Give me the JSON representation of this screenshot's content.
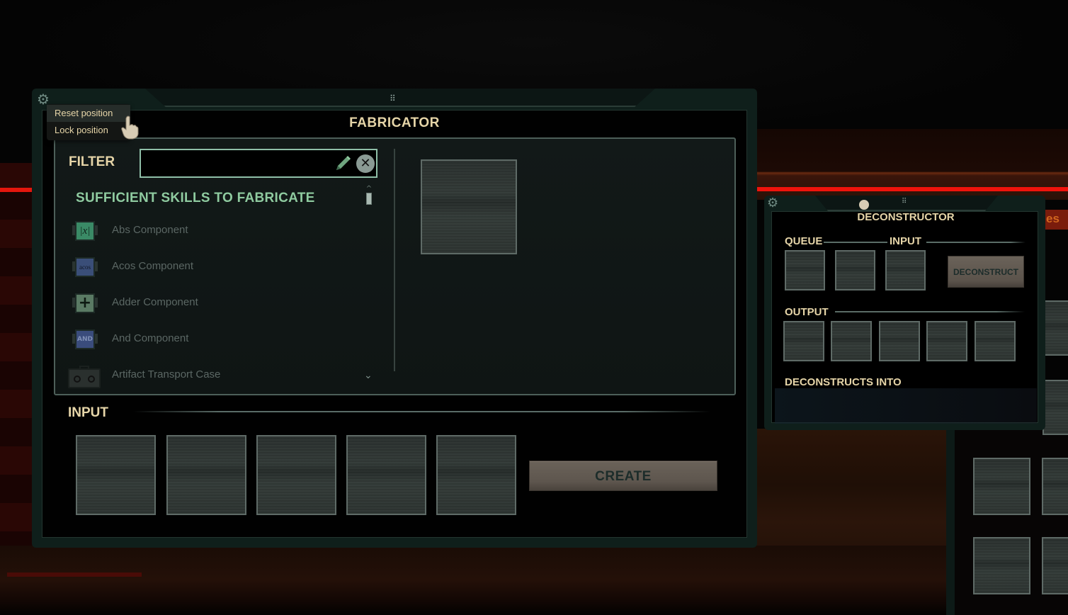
{
  "fabricator": {
    "title": "FABRICATOR",
    "settings_menu": {
      "items": [
        "Reset position",
        "Lock position"
      ]
    },
    "filter": {
      "label": "FILTER",
      "value": "",
      "placeholder": ""
    },
    "section_heading": "SUFFICIENT SKILLS TO FABRICATE",
    "items": [
      {
        "label": "Abs Component",
        "icon": "abs-component-icon",
        "glyph": "|x|",
        "color": "#3a8a66"
      },
      {
        "label": "Acos Component",
        "icon": "acos-component-icon",
        "glyph": "acos",
        "color": "#3a4e78"
      },
      {
        "label": "Adder Component",
        "icon": "adder-component-icon",
        "glyph": "+",
        "color": "#5a7a64"
      },
      {
        "label": "And Component",
        "icon": "and-component-icon",
        "glyph": "AND",
        "color": "#3a4c7c"
      },
      {
        "label": "Artifact Transport Case",
        "icon": "artifact-transport-case-icon",
        "glyph": "",
        "color": "#2a302e"
      }
    ],
    "input_label": "INPUT",
    "input_slot_count": 5,
    "create_label": "CREATE"
  },
  "deconstructor": {
    "title": "DECONSTRUCTOR",
    "queue_label": "QUEUE",
    "input_label": "INPUT",
    "output_label": "OUTPUT",
    "deconstruct_label": "DECONSTRUCT",
    "deconstructs_into_label": "DECONSTRUCTS INTO"
  },
  "background": {
    "sign_text": "es"
  },
  "colors": {
    "heading_gold": "#e6d5a8",
    "skill_green": "#8fcba0",
    "frame_teal": "#0f1f1b",
    "button_taupe": "#5e564e",
    "laser_red": "#f0130c"
  }
}
